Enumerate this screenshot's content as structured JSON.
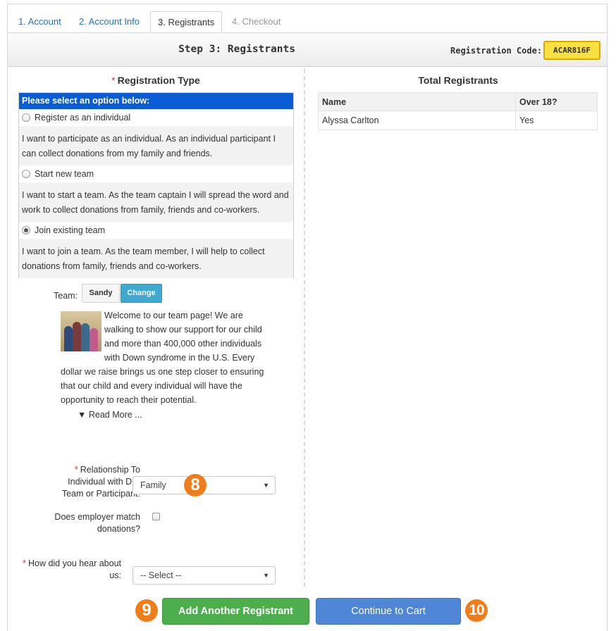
{
  "tabs": [
    {
      "label": "1. Account",
      "state": "link"
    },
    {
      "label": "2. Account Info",
      "state": "link"
    },
    {
      "label": "3. Registrants",
      "state": "active"
    },
    {
      "label": "4. Checkout",
      "state": "disabled"
    }
  ],
  "header": {
    "step_title": "Step 3: Registrants",
    "registration_code_label": "Registration Code:",
    "registration_code": "ACAR816F"
  },
  "registration_type": {
    "required_mark": "*",
    "title": "Registration Type",
    "prompt": "Please select an option below:",
    "options": [
      {
        "label": "Register as an individual",
        "description": "I want to participate as an individual.  As an individual participant I can collect donations from my family and friends.",
        "selected": false
      },
      {
        "label": "Start new team",
        "description": "I want to start a team.  As the team captain I will spread the word and work to collect donations from family, friends and co-workers.",
        "selected": false
      },
      {
        "label": "Join existing team",
        "description": "I want to join a team.  As the team member, I will help to collect donations from family, friends and co-workers.",
        "selected": true
      }
    ]
  },
  "team": {
    "label": "Team:",
    "name": "Sandy",
    "change_label": "Change",
    "description": "Welcome to our team page!  We are walking to show our support for our child and more than 400,000 other individuals with Down syndrome in the U.S.  Every dollar we raise brings us one step closer to ensuring that our child and every individual will have the opportunity to reach their potential.",
    "read_more": "▼ Read More ..."
  },
  "form": {
    "relationship": {
      "required_mark": "*",
      "label_lines": [
        "Relationship To",
        "Individual with DS,",
        "Team or Participant:"
      ],
      "value": "Family"
    },
    "employer_match": {
      "label_lines": [
        "Does employer match",
        "donations?"
      ],
      "checked": false
    },
    "hear_about": {
      "required_mark": "*",
      "label_lines": [
        "How did you hear about",
        "us:"
      ],
      "value": "-- Select --"
    }
  },
  "buttons": {
    "add_registrant": "Add Another Registrant",
    "continue_to_cart": "Continue to Cart"
  },
  "callouts": {
    "relationship": "8",
    "add": "9",
    "cart": "10"
  },
  "total_registrants": {
    "title": "Total Registrants",
    "columns": [
      "Name",
      "Over 18?"
    ],
    "rows": [
      [
        "Alyssa Carlton",
        "Yes"
      ]
    ]
  },
  "colors": {
    "prompt_bar": "#0a5cd5",
    "add_button": "#4cae4c",
    "cart_button": "#4f86d6",
    "callout": "#f07d1a",
    "code_badge": "#f7e040"
  }
}
